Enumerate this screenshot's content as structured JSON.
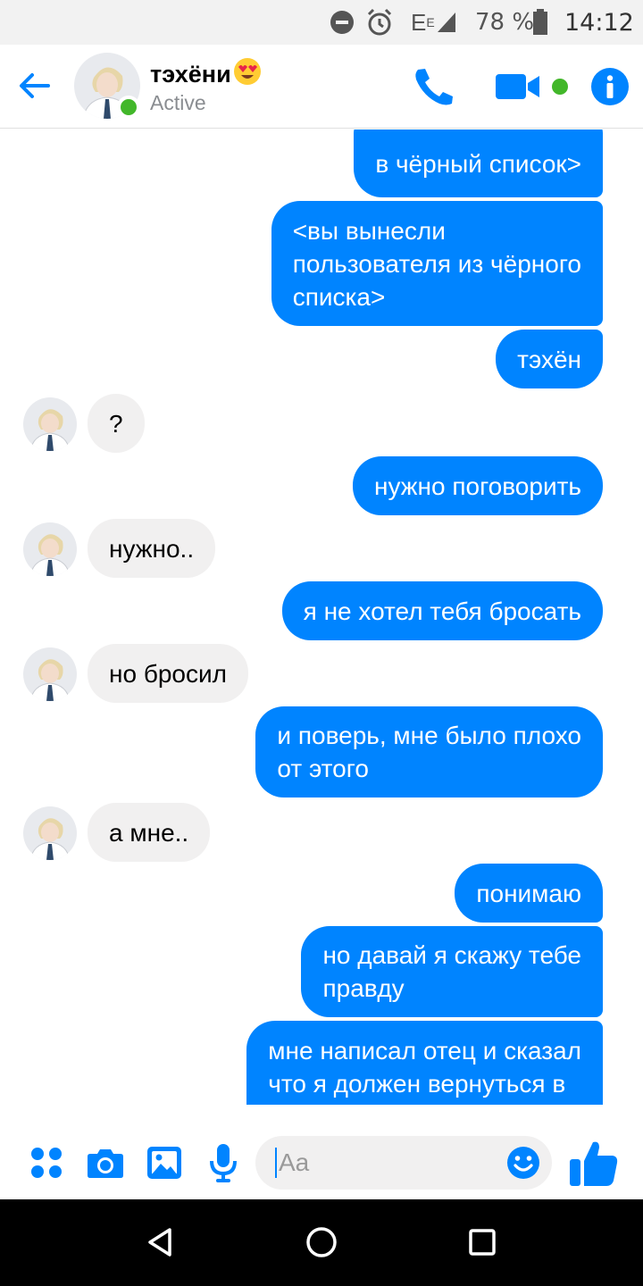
{
  "status_bar": {
    "network": "E",
    "network_superscript": "E",
    "battery_percent": "78 %",
    "time": "14:12"
  },
  "header": {
    "contact_name": "тэхёни",
    "status": "Active",
    "icons": [
      "back-arrow-icon",
      "phone-icon",
      "video-camera-icon",
      "info-icon"
    ]
  },
  "messages": [
    {
      "side": "out",
      "lines": [
        "в чёрный список>"
      ]
    },
    {
      "side": "out",
      "lines": [
        "<вы вынесли",
        "пользователя из чёрного",
        "списка>"
      ]
    },
    {
      "side": "out",
      "lines": [
        "тэхён"
      ]
    },
    {
      "side": "in",
      "lines": [
        "?"
      ]
    },
    {
      "side": "out",
      "lines": [
        "нужно поговорить"
      ]
    },
    {
      "side": "in",
      "lines": [
        "нужно.."
      ]
    },
    {
      "side": "out",
      "lines": [
        "я не хотел тебя бросать"
      ]
    },
    {
      "side": "in",
      "lines": [
        "но бросил"
      ]
    },
    {
      "side": "out",
      "lines": [
        "и поверь, мне было плохо",
        "от этого"
      ]
    },
    {
      "side": "in",
      "lines": [
        "а мне.."
      ]
    },
    {
      "side": "out",
      "lines": [
        "понимаю"
      ]
    },
    {
      "side": "out",
      "lines": [
        "но давай я скажу тебе",
        "правду"
      ]
    },
    {
      "side": "out",
      "lines": [
        "мне написал отец и сказал",
        "что я должен вернуться в"
      ]
    }
  ],
  "composer": {
    "placeholder": "Aa",
    "icons": [
      "apps-icon",
      "camera-icon",
      "gallery-icon",
      "microphone-icon",
      "emoji-icon",
      "thumbs-up-icon"
    ]
  },
  "colors": {
    "accent": "#0084ff",
    "online": "#42b72a",
    "incoming_bubble": "#f1f0f0"
  }
}
